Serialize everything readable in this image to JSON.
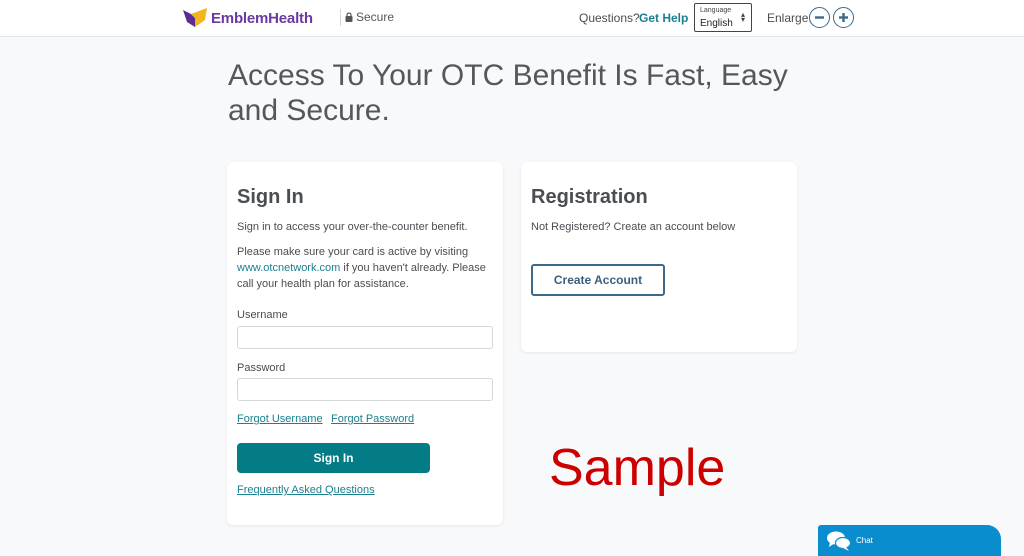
{
  "header": {
    "brand": "EmblemHealth",
    "secure_label": "Secure",
    "questions_label": "Questions?",
    "get_help_label": "Get Help",
    "language": {
      "label": "Language",
      "selected": "English"
    },
    "enlarge_label": "Enlarge:",
    "icons": {
      "logo": "emblemhealth-logo-icon",
      "lock": "lock-icon",
      "minus": "minus-circle-icon",
      "plus": "plus-circle-icon"
    },
    "colors": {
      "brand_purple": "#6b3aa0",
      "brand_yellow": "#f2b51c",
      "link_teal": "#1a7f8e"
    }
  },
  "page": {
    "title": "Access To Your OTC Benefit Is Fast, Easy and Secure."
  },
  "signin": {
    "title": "Sign In",
    "intro": "Sign in to access your over-the-counter benefit.",
    "notice_prefix": "Please make sure your card is active by visiting ",
    "notice_link": "www.otcnetwork.com",
    "notice_suffix": " if you haven't already. Please call your health plan for assistance.",
    "username_label": "Username",
    "username_value": "",
    "password_label": "Password",
    "password_value": "",
    "forgot_username": "Forgot Username",
    "forgot_password": "Forgot Password",
    "submit_label": "Sign In",
    "faq_label": "Frequently Asked Questions",
    "button_color": "#047c86"
  },
  "registration": {
    "title": "Registration",
    "text": "Not Registered? Create an account below",
    "create_account_label": "Create Account"
  },
  "watermark": {
    "text": "Sample",
    "color": "#cc0000"
  },
  "chat": {
    "label": "Chat",
    "icon": "chat-bubbles-icon",
    "color": "#0a8dcf"
  }
}
